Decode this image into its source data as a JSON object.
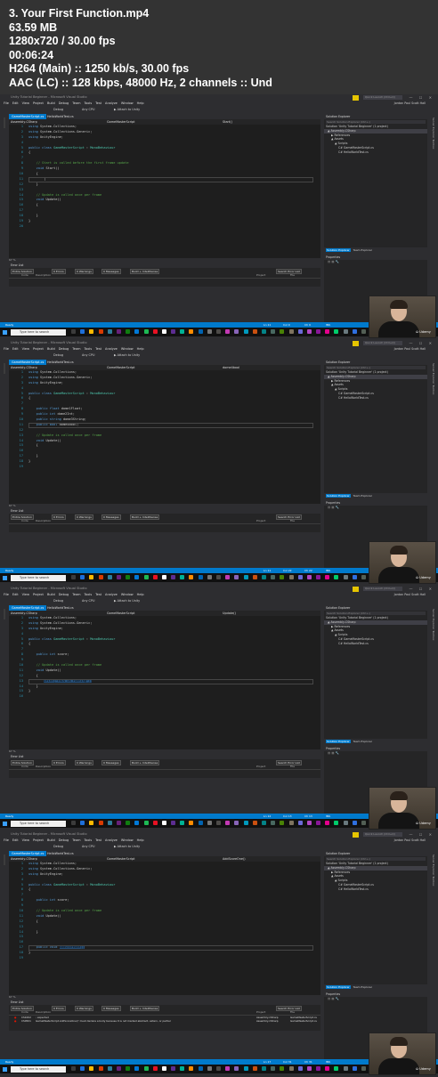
{
  "header": {
    "lines": [
      "3. Your First Function.mp4",
      "63.59 MB",
      "1280x720 / 30.00 fps",
      "00:06:24",
      "H264 (Main) :: 1250 kb/s, 30.00 fps",
      "AAC (LC) :: 128 kbps, 48000 Hz, 2 channels :: Und"
    ]
  },
  "common": {
    "window_title": "Unity Tutorial Beginner - Microsoft Visual Studio",
    "quick_launch": "Quick Launch (Ctrl+Q)",
    "window_buttons": "— ☐ ✕",
    "menu": [
      "File",
      "Edit",
      "View",
      "Project",
      "Build",
      "Debug",
      "Team",
      "Tools",
      "Test",
      "Analyze",
      "Window",
      "Help"
    ],
    "user_name": "Jordan Paul Scott Hall",
    "toolbar": {
      "config": "Debug",
      "platform": "Any CPU",
      "attach": "▶ Attach to Unity"
    },
    "tabs": [
      "GameMasterScript.cs",
      "HelloWorldTest.cs"
    ],
    "project_nav": "Assembly-CSharp",
    "class_nav": "GameMasterScript",
    "solution_explorer": {
      "title": "Solution Explorer",
      "search": "Search Solution Explorer (Ctrl+;)",
      "items": [
        "Solution 'Unity Tutorial Beginner' (1 project)",
        "▲ Assembly-CSharp",
        "▶ References",
        "▲ Assets",
        "▲ Scripts",
        "C# GameMasterScript.cs",
        "C# HelloWorldTest.cs"
      ],
      "tabs": [
        "Solution Explorer",
        "Team Explorer"
      ]
    },
    "properties": {
      "title": "Properties"
    },
    "side_label": "Server Explorer  Toolbox",
    "zoom": "67 %",
    "error_list": {
      "title": "Error List",
      "scope": "Entire Solution",
      "errors": "0 Errors",
      "warnings": "0 Warnings",
      "messages": "0 Messages",
      "build": "Build + IntelliSense",
      "search": "Search Error List",
      "columns": [
        "Code",
        "Description",
        "Project",
        "File"
      ]
    },
    "taskbar": {
      "search": "Type here to search",
      "icon_colors": [
        "#3b3b3b",
        "#1e6fd9",
        "#ffb900",
        "#d83b01",
        "#2d7d9a",
        "#68217a",
        "#107c10",
        "#0078d7",
        "#1db954",
        "#e81123",
        "#ffffff",
        "#5c2d91",
        "#00b294",
        "#ff8c00",
        "#0063b1",
        "#767676",
        "#4c4a48",
        "#c239b3",
        "#8764b8",
        "#0099bc",
        "#ca5010",
        "#038387",
        "#486860",
        "#498205",
        "#7e735f",
        "#6b69d6",
        "#b146c2",
        "#881798",
        "#e3008c",
        "#00cc6a",
        "#69797e",
        "#2f6fdf",
        "#525e54"
      ],
      "clock": "▲ ♪ 🖧"
    },
    "webcam_logo": "ῶ Udemy"
  },
  "frames": [
    {
      "status": "Ready",
      "status_ln": "Ln 11",
      "status_col": "Col 9",
      "status_ch": "Ch 9",
      "status_ins": "INS",
      "member_nav": "Start()",
      "code": [
        [
          "1",
          [
            [
              "kw",
              "using"
            ],
            [
              "tx",
              " System.Collections;"
            ]
          ]
        ],
        [
          "2",
          [
            [
              "kw",
              "using"
            ],
            [
              "tx",
              " System.Collections.Generic;"
            ]
          ]
        ],
        [
          "3",
          [
            [
              "kw",
              "using"
            ],
            [
              "tx",
              " UnityEngine;"
            ]
          ]
        ],
        [
          "4",
          []
        ],
        [
          "5",
          [
            [
              "kw",
              "public class"
            ],
            [
              "tx",
              " "
            ],
            [
              "ty",
              "GameMasterScript"
            ],
            [
              "tx",
              " : "
            ],
            [
              "ty",
              "MonoBehaviour"
            ]
          ]
        ],
        [
          "6",
          [
            [
              "tx",
              "{"
            ]
          ]
        ],
        [
          "7",
          []
        ],
        [
          "8",
          [
            [
              "tx",
              "    "
            ],
            [
              "cm",
              "// Start is called before the first frame update"
            ]
          ]
        ],
        [
          "9",
          [
            [
              "tx",
              "    "
            ],
            [
              "kw",
              "void"
            ],
            [
              "tx",
              " Start()"
            ]
          ]
        ],
        [
          "10",
          [
            [
              "tx",
              "    {"
            ]
          ]
        ],
        [
          "11",
          [
            [
              "tx",
              "        |"
            ]
          ]
        ],
        [
          "12",
          [
            [
              "tx",
              "    }"
            ]
          ]
        ],
        [
          "13",
          []
        ],
        [
          "14",
          [
            [
              "tx",
              "    "
            ],
            [
              "cm",
              "// Update is called once per frame"
            ]
          ]
        ],
        [
          "15",
          [
            [
              "tx",
              "    "
            ],
            [
              "kw",
              "void"
            ],
            [
              "tx",
              " Update()"
            ]
          ]
        ],
        [
          "16",
          [
            [
              "tx",
              "    {"
            ]
          ]
        ],
        [
          "17",
          []
        ],
        [
          "18",
          [
            [
              "tx",
              "    }"
            ]
          ]
        ],
        [
          "19",
          [
            [
              "tx",
              "}"
            ]
          ]
        ],
        [
          "20",
          []
        ]
      ],
      "current_line": 10,
      "errors": []
    },
    {
      "status": "Ready",
      "status_ln": "Ln 11",
      "status_col": "Col 22",
      "status_ch": "Ch 22",
      "status_ins": "INS",
      "member_nav": "dome4bool",
      "code": [
        [
          "1",
          [
            [
              "kw",
              "using"
            ],
            [
              "tx",
              " System.Collections;"
            ]
          ]
        ],
        [
          "2",
          [
            [
              "kw",
              "using"
            ],
            [
              "tx",
              " System.Collections.Generic;"
            ]
          ]
        ],
        [
          "3",
          [
            [
              "kw",
              "using"
            ],
            [
              "tx",
              " UnityEngine;"
            ]
          ]
        ],
        [
          "4",
          []
        ],
        [
          "5",
          [
            [
              "kw",
              "public class"
            ],
            [
              "tx",
              " "
            ],
            [
              "ty",
              "GameMasterScript"
            ],
            [
              "tx",
              " : "
            ],
            [
              "ty",
              "MonoBehaviour"
            ]
          ]
        ],
        [
          "6",
          [
            [
              "tx",
              "{"
            ]
          ]
        ],
        [
          "7",
          []
        ],
        [
          "8",
          [
            [
              "tx",
              "    "
            ],
            [
              "kw",
              "public float"
            ],
            [
              "tx",
              " dome1Float;"
            ]
          ]
        ],
        [
          "9",
          [
            [
              "tx",
              "    "
            ],
            [
              "kw",
              "public int"
            ],
            [
              "tx",
              " dome2Int;"
            ]
          ]
        ],
        [
          "10",
          [
            [
              "tx",
              "    "
            ],
            [
              "kw",
              "public string"
            ],
            [
              "tx",
              " dome3String;"
            ]
          ]
        ],
        [
          "11",
          [
            [
              "tx",
              "    "
            ],
            [
              "kw",
              "public bool"
            ],
            [
              "tx",
              " dome4bool;"
            ]
          ]
        ],
        [
          "12",
          []
        ],
        [
          "13",
          [
            [
              "tx",
              "    "
            ],
            [
              "cm",
              "// Update is called once per frame"
            ]
          ]
        ],
        [
          "14",
          [
            [
              "tx",
              "    "
            ],
            [
              "kw",
              "void"
            ],
            [
              "tx",
              " Update()"
            ]
          ]
        ],
        [
          "15",
          [
            [
              "tx",
              "    {"
            ]
          ]
        ],
        [
          "16",
          []
        ],
        [
          "17",
          [
            [
              "tx",
              "    }"
            ]
          ]
        ],
        [
          "18",
          [
            [
              "tx",
              "}"
            ]
          ]
        ],
        [
          "19",
          []
        ]
      ],
      "current_line": 10,
      "errors": []
    },
    {
      "status": "Ready",
      "status_ln": "Ln 12",
      "status_col": "Col 13",
      "status_ch": "Ch 13",
      "status_ins": "INS",
      "member_nav": "Update()",
      "code": [
        [
          "1",
          [
            [
              "kw",
              "using"
            ],
            [
              "tx",
              " System.Collections;"
            ]
          ]
        ],
        [
          "2",
          [
            [
              "kw",
              "using"
            ],
            [
              "tx",
              " System.Collections.Generic;"
            ]
          ]
        ],
        [
          "3",
          [
            [
              "kw",
              "using"
            ],
            [
              "tx",
              " UnityEngine;"
            ]
          ]
        ],
        [
          "4",
          []
        ],
        [
          "5",
          [
            [
              "kw",
              "public class"
            ],
            [
              "tx",
              " "
            ],
            [
              "ty",
              "GameMasterScript"
            ],
            [
              "tx",
              " : "
            ],
            [
              "ty",
              "MonoBehaviour"
            ]
          ]
        ],
        [
          "6",
          [
            [
              "tx",
              "{"
            ]
          ]
        ],
        [
          "7",
          []
        ],
        [
          "8",
          [
            [
              "tx",
              "    "
            ],
            [
              "kw",
              "public int"
            ],
            [
              "tx",
              " score;"
            ]
          ]
        ],
        [
          "9",
          []
        ],
        [
          "10",
          [
            [
              "tx",
              "    "
            ],
            [
              "cm",
              "// Update is called once per frame"
            ]
          ]
        ],
        [
          "11",
          [
            [
              "tx",
              "    "
            ],
            [
              "kw",
              "void"
            ],
            [
              "tx",
              " Update()"
            ]
          ]
        ],
        [
          "12",
          [
            [
              "tx",
              "    {"
            ]
          ]
        ],
        [
          "13",
          [
            [
              "tx",
              "        "
            ],
            [
              "sel",
              "print(\"this is running\");"
            ]
          ]
        ],
        [
          "14",
          [
            [
              "tx",
              "    }"
            ]
          ]
        ],
        [
          "15",
          [
            [
              "tx",
              "}"
            ]
          ]
        ],
        [
          "16",
          []
        ]
      ],
      "current_line": 12,
      "errors": []
    },
    {
      "status": "Ready",
      "status_ln": "Ln 17",
      "status_col": "Col 31",
      "status_ch": "Ch 31",
      "status_ins": "INS",
      "member_nav": "AddScoreOne()",
      "code": [
        [
          "1",
          [
            [
              "kw",
              "using"
            ],
            [
              "tx",
              " System.Collections;"
            ]
          ]
        ],
        [
          "2",
          [
            [
              "kw",
              "using"
            ],
            [
              "tx",
              " System.Collections.Generic;"
            ]
          ]
        ],
        [
          "3",
          [
            [
              "kw",
              "using"
            ],
            [
              "tx",
              " UnityEngine;"
            ]
          ]
        ],
        [
          "4",
          []
        ],
        [
          "5",
          [
            [
              "kw",
              "public class"
            ],
            [
              "tx",
              " "
            ],
            [
              "ty",
              "GameMasterScript"
            ],
            [
              "tx",
              " : "
            ],
            [
              "ty",
              "MonoBehaviour"
            ]
          ]
        ],
        [
          "6",
          [
            [
              "tx",
              "{"
            ]
          ]
        ],
        [
          "7",
          []
        ],
        [
          "8",
          [
            [
              "tx",
              "    "
            ],
            [
              "kw",
              "public int"
            ],
            [
              "tx",
              " score;"
            ]
          ]
        ],
        [
          "9",
          []
        ],
        [
          "10",
          [
            [
              "tx",
              "    "
            ],
            [
              "cm",
              "// Update is called once per frame"
            ]
          ]
        ],
        [
          "11",
          [
            [
              "tx",
              "    "
            ],
            [
              "kw",
              "void"
            ],
            [
              "tx",
              " Update()"
            ]
          ]
        ],
        [
          "12",
          [
            [
              "tx",
              "    {"
            ]
          ]
        ],
        [
          "13",
          []
        ],
        [
          "14",
          [
            [
              "tx",
              "    }"
            ]
          ]
        ],
        [
          "15",
          []
        ],
        [
          "16",
          []
        ],
        [
          "17",
          [
            [
              "tx",
              "    "
            ],
            [
              "kw",
              "public void"
            ],
            [
              "tx",
              " "
            ],
            [
              "sel",
              "AddScoreOne()"
            ]
          ]
        ],
        [
          "18",
          [
            [
              "tx",
              "}"
            ]
          ]
        ],
        [
          "19",
          []
        ]
      ],
      "current_line": 16,
      "errors": [
        [
          "CS1002",
          "; expected",
          "Assembly-CSharp",
          "GameMasterScript.cs"
        ],
        [
          "CS0501",
          "GameMasterScript.AddScoreOne()' must declare a body because it is not marked abstract, extern, or partial",
          "Assembly-CSharp",
          "GameMasterScript.cs"
        ]
      ]
    }
  ]
}
